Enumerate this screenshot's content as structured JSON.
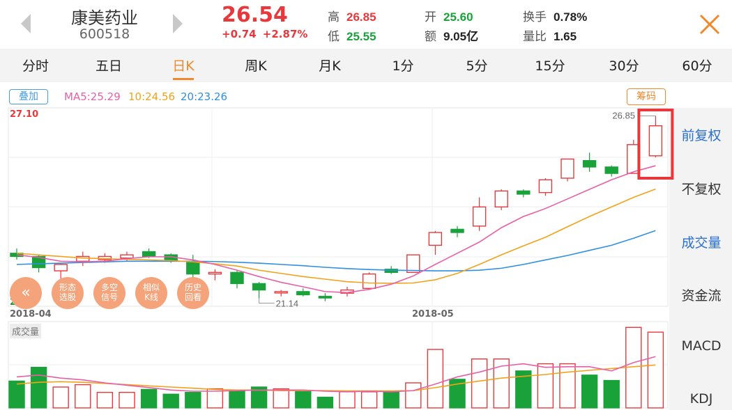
{
  "header": {
    "stock_name": "康美药业",
    "stock_code": "600518",
    "price": "26.54",
    "change": "+0.74  +2.87%",
    "quotes": [
      {
        "label": "高",
        "value": "26.85"
      },
      {
        "label": "低",
        "value": "25.55"
      },
      {
        "label": "开",
        "value": "25.60"
      },
      {
        "label": "额",
        "value": "9.05亿"
      },
      {
        "label": "换手",
        "value": "0.78%"
      },
      {
        "label": "量比",
        "value": "1.65"
      }
    ]
  },
  "tabs": [
    "分时",
    "五日",
    "日K",
    "周K",
    "月K",
    "1分",
    "5分",
    "15分",
    "30分",
    "60分"
  ],
  "active_tab": "日K",
  "chart_header": {
    "overlay": "叠加",
    "ma5": "MA5:25.29",
    "ma10": "10:24.56",
    "ma20": "20:23.26",
    "chips": "筹码"
  },
  "sidebar": [
    "前复权",
    "不复权",
    "成交量",
    "资金流",
    "MACD",
    "KDJ"
  ],
  "feature_buttons": [
    {
      "line1": "形态",
      "line2": "选股"
    },
    {
      "line1": "多空",
      "line2": "信号"
    },
    {
      "line1": "相似",
      "line2": "K线"
    },
    {
      "line1": "历史",
      "line2": "回看"
    }
  ],
  "volume_label": "成交量",
  "colors": {
    "up": "#e8383c",
    "down": "#1aa23a",
    "accent": "#f0882c",
    "ma5": "#e75fa6",
    "ma10": "#f2a21a",
    "ma20": "#2f8fe0"
  },
  "chart_data": {
    "type": "candlestick",
    "ylim": [
      20.89,
      27.1
    ],
    "y_axis_top_label": "27.10",
    "y_axis_bottom_label": "20.89",
    "x_labels": [
      {
        "index": 0,
        "label": "2018-04"
      },
      {
        "index": 19,
        "label": "2018-05"
      }
    ],
    "annotations": [
      {
        "label": "26.85",
        "index": 29,
        "value": 26.85
      },
      {
        "label": "21.14",
        "index": 11,
        "value": 21.14
      }
    ],
    "candles": [
      {
        "o": 22.55,
        "c": 22.45,
        "h": 22.7,
        "l": 22.35,
        "v": 4.5
      },
      {
        "o": 22.45,
        "c": 22.1,
        "h": 22.5,
        "l": 21.95,
        "v": 6.8
      },
      {
        "o": 22.0,
        "c": 22.2,
        "h": 22.25,
        "l": 21.75,
        "v": 3.5
      },
      {
        "o": 22.3,
        "c": 22.45,
        "h": 22.6,
        "l": 22.15,
        "v": 3.9
      },
      {
        "o": 22.35,
        "c": 22.45,
        "h": 22.55,
        "l": 22.25,
        "v": 2.6
      },
      {
        "o": 22.4,
        "c": 22.5,
        "h": 22.6,
        "l": 22.3,
        "v": 2.6
      },
      {
        "o": 22.6,
        "c": 22.45,
        "h": 22.7,
        "l": 22.4,
        "v": 3.1
      },
      {
        "o": 22.5,
        "c": 22.3,
        "h": 22.55,
        "l": 22.25,
        "v": 2.3
      },
      {
        "o": 22.3,
        "c": 21.9,
        "h": 22.5,
        "l": 21.8,
        "v": 2.6
      },
      {
        "o": 21.9,
        "c": 21.95,
        "h": 22.05,
        "l": 21.7,
        "v": 3.2
      },
      {
        "o": 21.95,
        "c": 21.6,
        "h": 22.0,
        "l": 21.45,
        "v": 2.9
      },
      {
        "o": 21.6,
        "c": 21.4,
        "h": 21.65,
        "l": 21.14,
        "v": 3.5
      },
      {
        "o": 21.35,
        "c": 21.35,
        "h": 21.4,
        "l": 21.2,
        "v": 3.2
      },
      {
        "o": 21.35,
        "c": 21.25,
        "h": 21.45,
        "l": 21.2,
        "v": 2.9
      },
      {
        "o": 21.2,
        "c": 21.15,
        "h": 21.3,
        "l": 21.05,
        "v": 1.8
      },
      {
        "o": 21.3,
        "c": 21.4,
        "h": 21.5,
        "l": 21.2,
        "v": 2.7
      },
      {
        "o": 21.45,
        "c": 21.9,
        "h": 21.95,
        "l": 21.4,
        "v": 2.7
      },
      {
        "o": 22.05,
        "c": 21.95,
        "h": 22.15,
        "l": 21.9,
        "v": 2.7
      },
      {
        "o": 21.95,
        "c": 22.5,
        "h": 22.5,
        "l": 21.95,
        "v": 4.2
      },
      {
        "o": 22.8,
        "c": 23.2,
        "h": 23.25,
        "l": 22.5,
        "v": 9.8
      },
      {
        "o": 23.3,
        "c": 23.2,
        "h": 23.4,
        "l": 23.05,
        "v": 4.8
      },
      {
        "o": 23.4,
        "c": 24.0,
        "h": 24.3,
        "l": 23.25,
        "v": 8.2
      },
      {
        "o": 24.0,
        "c": 24.5,
        "h": 24.55,
        "l": 23.9,
        "v": 8.2
      },
      {
        "o": 24.5,
        "c": 24.4,
        "h": 24.55,
        "l": 24.3,
        "v": 6.2
      },
      {
        "o": 24.45,
        "c": 24.85,
        "h": 24.9,
        "l": 24.35,
        "v": 7.4
      },
      {
        "o": 24.9,
        "c": 25.5,
        "h": 25.5,
        "l": 24.8,
        "v": 7.4
      },
      {
        "o": 25.45,
        "c": 25.25,
        "h": 25.7,
        "l": 25.1,
        "v": 5.5
      },
      {
        "o": 25.25,
        "c": 25.05,
        "h": 25.3,
        "l": 24.95,
        "v": 4.6
      },
      {
        "o": 25.05,
        "c": 25.95,
        "h": 26.1,
        "l": 25.05,
        "v": 13.5
      },
      {
        "o": 25.6,
        "c": 26.54,
        "h": 26.85,
        "l": 25.55,
        "v": 12.7
      }
    ],
    "ma5": [
      22.5,
      22.42,
      22.3,
      22.28,
      22.3,
      22.38,
      22.44,
      22.44,
      22.34,
      22.2,
      22.02,
      21.82,
      21.64,
      21.5,
      21.35,
      21.32,
      21.42,
      21.58,
      21.84,
      22.2,
      22.55,
      22.9,
      23.35,
      23.7,
      23.95,
      24.25,
      24.55,
      24.85,
      25.1,
      25.29
    ],
    "ma10": [
      22.55,
      22.5,
      22.45,
      22.4,
      22.38,
      22.36,
      22.34,
      22.32,
      22.28,
      22.22,
      22.15,
      22.02,
      21.92,
      21.82,
      21.74,
      21.66,
      21.62,
      21.61,
      21.62,
      21.72,
      21.92,
      22.2,
      22.5,
      22.78,
      23.05,
      23.38,
      23.7,
      24.0,
      24.3,
      24.56
    ],
    "ma20": [
      22.2,
      22.22,
      22.24,
      22.26,
      22.28,
      22.3,
      22.3,
      22.3,
      22.3,
      22.29,
      22.27,
      22.24,
      22.2,
      22.16,
      22.11,
      22.07,
      22.04,
      22.02,
      22.01,
      22.0,
      22.0,
      22.02,
      22.08,
      22.2,
      22.34,
      22.48,
      22.64,
      22.8,
      23.02,
      23.26
    ],
    "vol_ma5": [
      5.2,
      5.5,
      5.0,
      4.7,
      4.2,
      3.8,
      3.4,
      3.0,
      2.8,
      2.8,
      2.9,
      3.0,
      3.0,
      3.0,
      2.8,
      2.7,
      2.8,
      2.7,
      2.9,
      4.0,
      5.2,
      6.0,
      7.0,
      7.4,
      6.8,
      6.9,
      6.9,
      6.2,
      7.6,
      8.6
    ],
    "vol_ma10": [
      4.0,
      4.3,
      4.4,
      4.3,
      4.1,
      3.9,
      3.7,
      3.5,
      3.3,
      3.1,
      3.0,
      3.0,
      2.9,
      2.9,
      2.9,
      2.85,
      2.85,
      2.85,
      2.9,
      3.4,
      4.0,
      4.5,
      5.0,
      5.3,
      5.6,
      6.0,
      6.3,
      6.6,
      6.9,
      7.2
    ]
  }
}
